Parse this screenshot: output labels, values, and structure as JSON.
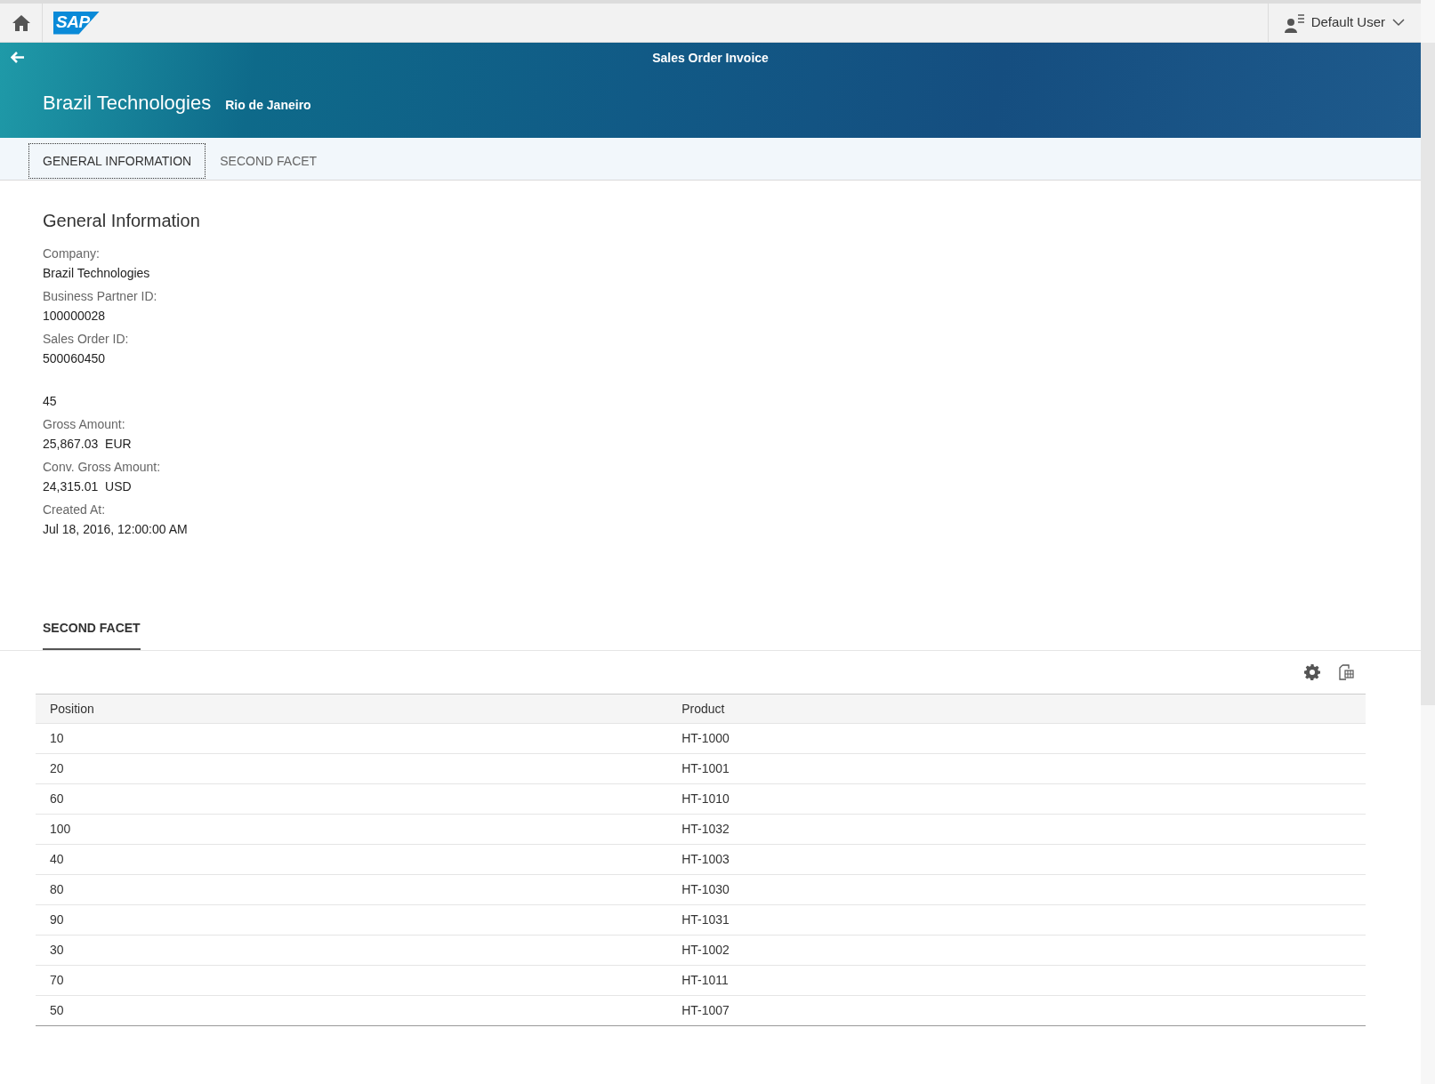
{
  "shell": {
    "logo": "SAP",
    "user": "Default User"
  },
  "header": {
    "app_title": "Sales Order Invoice",
    "title": "Brazil Technologies",
    "subtitle": "Rio de Janeiro"
  },
  "tabs": [
    {
      "label": "GENERAL INFORMATION",
      "selected": true
    },
    {
      "label": "SECOND FACET",
      "selected": false
    }
  ],
  "general_information": {
    "title": "General Information",
    "fields": [
      {
        "label": "Company:",
        "value": "Brazil Technologies"
      },
      {
        "label": "Business Partner ID:",
        "value": "100000028"
      },
      {
        "label": "Sales Order ID:",
        "value": "500060450"
      },
      {
        "value": "45"
      },
      {
        "label": "Gross Amount:",
        "value": "25,867.03  EUR"
      },
      {
        "label": "Conv. Gross Amount:",
        "value": "24,315.01  USD"
      },
      {
        "label": "Created At:",
        "value": "Jul 18, 2016, 12:00:00 AM"
      }
    ]
  },
  "second_facet": {
    "title": "SECOND FACET",
    "table": {
      "columns": [
        "Position",
        "Product"
      ],
      "rows": [
        [
          "10",
          "HT-1000"
        ],
        [
          "20",
          "HT-1001"
        ],
        [
          "60",
          "HT-1010"
        ],
        [
          "100",
          "HT-1032"
        ],
        [
          "40",
          "HT-1003"
        ],
        [
          "80",
          "HT-1030"
        ],
        [
          "90",
          "HT-1031"
        ],
        [
          "30",
          "HT-1002"
        ],
        [
          "70",
          "HT-1011"
        ],
        [
          "50",
          "HT-1007"
        ]
      ]
    }
  }
}
